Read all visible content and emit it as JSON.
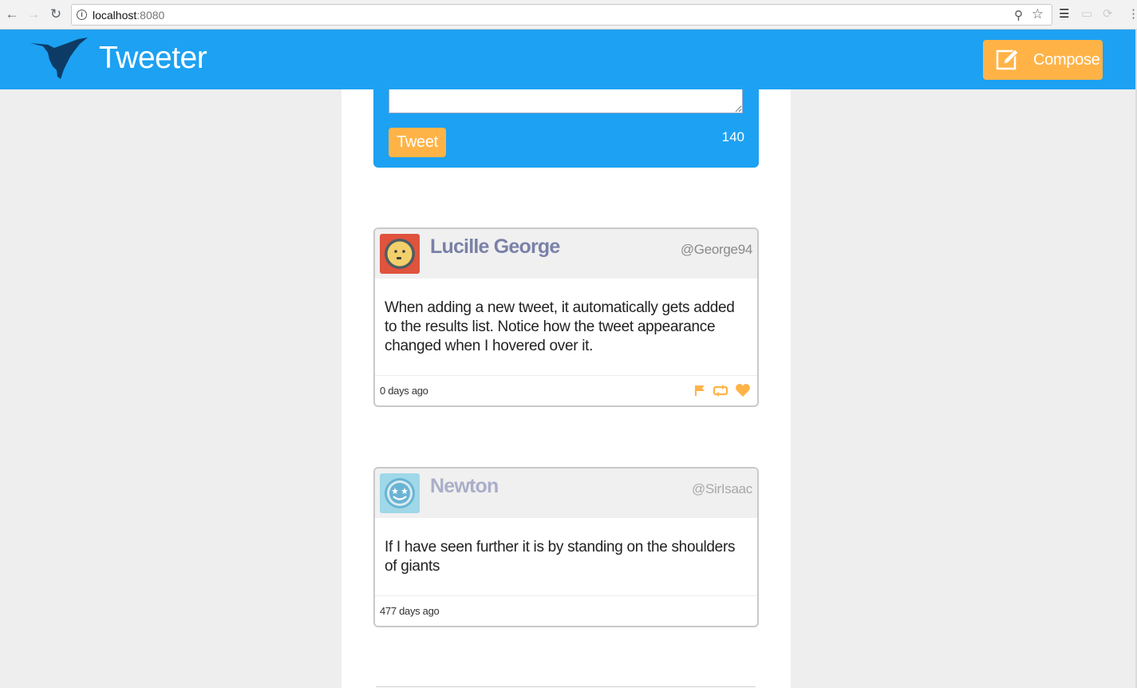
{
  "browser": {
    "url_host": "localhost",
    "url_port": ":8080"
  },
  "header": {
    "title": "Tweeter",
    "compose_label": "Compose"
  },
  "composer": {
    "textarea_value": "",
    "tweet_label": "Tweet",
    "counter": "140"
  },
  "tweets": [
    {
      "name": "Lucille George",
      "handle": "@George94",
      "text": "When adding a new tweet, it automatically gets added to the results list. Notice how the tweet appearance changed when I hovered over it.",
      "time": "0 days ago",
      "actions": [
        "flag-icon",
        "retweet-icon",
        "heart-icon"
      ]
    },
    {
      "name": "Newton",
      "handle": "@SirIsaac",
      "text": "If I have seen further it is by standing on the shoulders of giants",
      "time": "477 days ago"
    }
  ],
  "colors": {
    "brand": "#1da1f2",
    "accent": "#ffb347",
    "author_name": "#7a81a8"
  }
}
